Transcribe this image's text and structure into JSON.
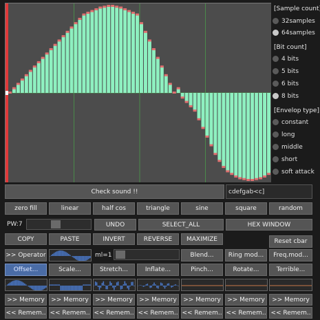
{
  "wave_samples": [
    0.0,
    0.05,
    0.1,
    0.15,
    0.2,
    0.25,
    0.3,
    0.35,
    0.4,
    0.45,
    0.5,
    0.55,
    0.6,
    0.65,
    0.7,
    0.75,
    0.8,
    0.85,
    0.9,
    0.92,
    0.94,
    0.96,
    0.98,
    0.99,
    1.0,
    1.0,
    0.99,
    0.98,
    0.96,
    0.94,
    0.92,
    0.9,
    0.8,
    0.7,
    0.6,
    0.5,
    0.4,
    0.3,
    0.2,
    0.1,
    0.0,
    0.05,
    -0.05,
    -0.1,
    -0.15,
    -0.2,
    -0.3,
    -0.4,
    -0.5,
    -0.6,
    -0.7,
    -0.78,
    -0.85,
    -0.9,
    -0.93,
    -0.96,
    -0.98,
    -0.99,
    -1.0,
    -1.0,
    -0.99,
    -0.98,
    -0.96,
    -0.93
  ],
  "colors": {
    "wave_bg": "#4c4c4c",
    "bar_fill": "#8ef0c0",
    "bar_tip": "#e07070",
    "grid_line": "#4a8a4a",
    "cursor_line": "#e03a3a",
    "button_highlight": "#4a6ca6"
  },
  "sample_count": {
    "title": "[Sample count]",
    "options": [
      "32samples",
      "64samples"
    ],
    "selected": "64samples"
  },
  "bit_count": {
    "title": "[Bit count]",
    "options": [
      "4 bits",
      "5 bits",
      "6 bits",
      "8 bits"
    ],
    "selected": "8 bits"
  },
  "envelope": {
    "title": "[Envelop type]",
    "options": [
      "constant",
      "long",
      "middle",
      "short",
      "soft attack"
    ],
    "selected": ""
  },
  "check_sound": "Check sound !!",
  "mml": "cdefgab<c]",
  "wave_presets": [
    "zero fill",
    "linear",
    "half cos",
    "triangle",
    "sine",
    "square",
    "random"
  ],
  "pw": {
    "label": "PW:7",
    "level": 7,
    "max": 16
  },
  "undo": "UNDO",
  "select_all": "SELECT_ALL",
  "hex_window": "HEX WINDOW",
  "edit_buttons": [
    "COPY",
    "PASTE",
    "INVERT",
    "REVERSE",
    "MAXIMIZE"
  ],
  "reset_cbar": "Reset cbar",
  "operator": ">> Operator",
  "offset": "Offset...",
  "ml": {
    "label": "ml=1",
    "level": 1
  },
  "ops_row1": [
    "Blend...",
    "Ring mod...",
    "Freq.mod..."
  ],
  "ops_row2": [
    "Scale...",
    "Stretch...",
    "Inflate...",
    "Pinch...",
    "Rotate...",
    "Terrible..."
  ],
  "memory_store": [
    ">> Memory",
    ">> Memory",
    ">> Memory",
    ">> Memory",
    ">> Memory",
    ">> Memory",
    ">> Memory"
  ],
  "memory_recall": [
    "<< Remem..",
    "<< Remem..",
    "<< Remem..",
    "<< Remem..",
    "<< Remem..",
    "<< Remem..",
    "<< Remem.."
  ]
}
